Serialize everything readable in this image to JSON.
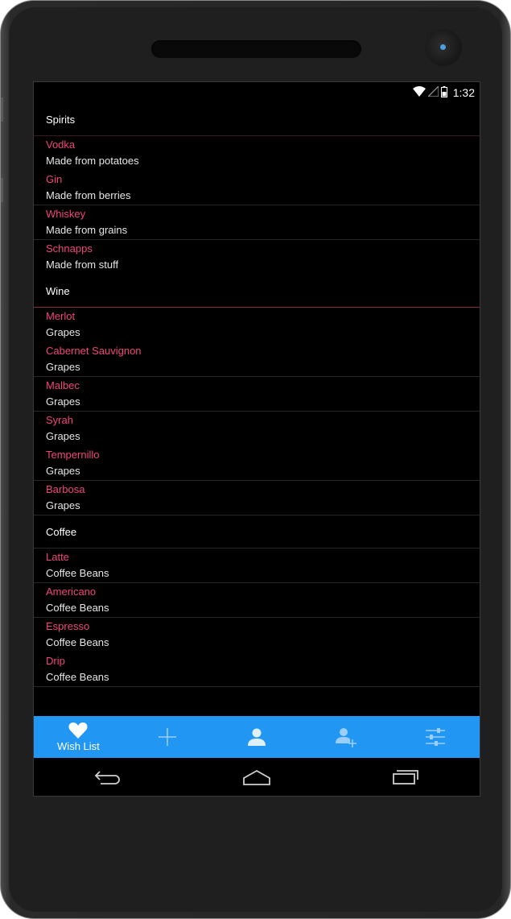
{
  "status_bar": {
    "time": "1:32",
    "icons": [
      "wifi-icon",
      "signal-icon",
      "battery-icon"
    ]
  },
  "sections": [
    {
      "header": "Spirits",
      "items": [
        {
          "title": "Vodka",
          "desc": "Made from potatoes"
        },
        {
          "title": "Gin",
          "desc": "Made from berries"
        },
        {
          "title": "Whiskey",
          "desc": "Made from grains"
        },
        {
          "title": "Schnapps",
          "desc": "Made from stuff"
        }
      ]
    },
    {
      "header": "Wine",
      "items": [
        {
          "title": "Merlot",
          "desc": "Grapes"
        },
        {
          "title": "Cabernet Sauvignon",
          "desc": "Grapes"
        },
        {
          "title": "Malbec",
          "desc": "Grapes"
        },
        {
          "title": "Syrah",
          "desc": "Grapes"
        },
        {
          "title": "Tempernillo",
          "desc": "Grapes"
        },
        {
          "title": "Barbosa",
          "desc": "Grapes"
        }
      ]
    },
    {
      "header": "Coffee",
      "items": [
        {
          "title": "Latte",
          "desc": "Coffee Beans"
        },
        {
          "title": "Americano",
          "desc": "Coffee Beans"
        },
        {
          "title": "Espresso",
          "desc": "Coffee Beans"
        },
        {
          "title": "Drip",
          "desc": "Coffee Beans"
        }
      ]
    }
  ],
  "tabbar": {
    "tabs": [
      {
        "label": "Wish List",
        "icon": "heart-icon",
        "selected": true
      },
      {
        "label": "",
        "icon": "plus-icon"
      },
      {
        "label": "",
        "icon": "person-icon"
      },
      {
        "label": "",
        "icon": "add-person-icon"
      },
      {
        "label": "",
        "icon": "sliders-icon"
      }
    ]
  },
  "navbar": {
    "icons": [
      "back-icon",
      "home-icon",
      "recents-icon"
    ]
  },
  "colors": {
    "accent": "#f0467a",
    "tabbar": "#2196f3",
    "background": "#000000"
  }
}
